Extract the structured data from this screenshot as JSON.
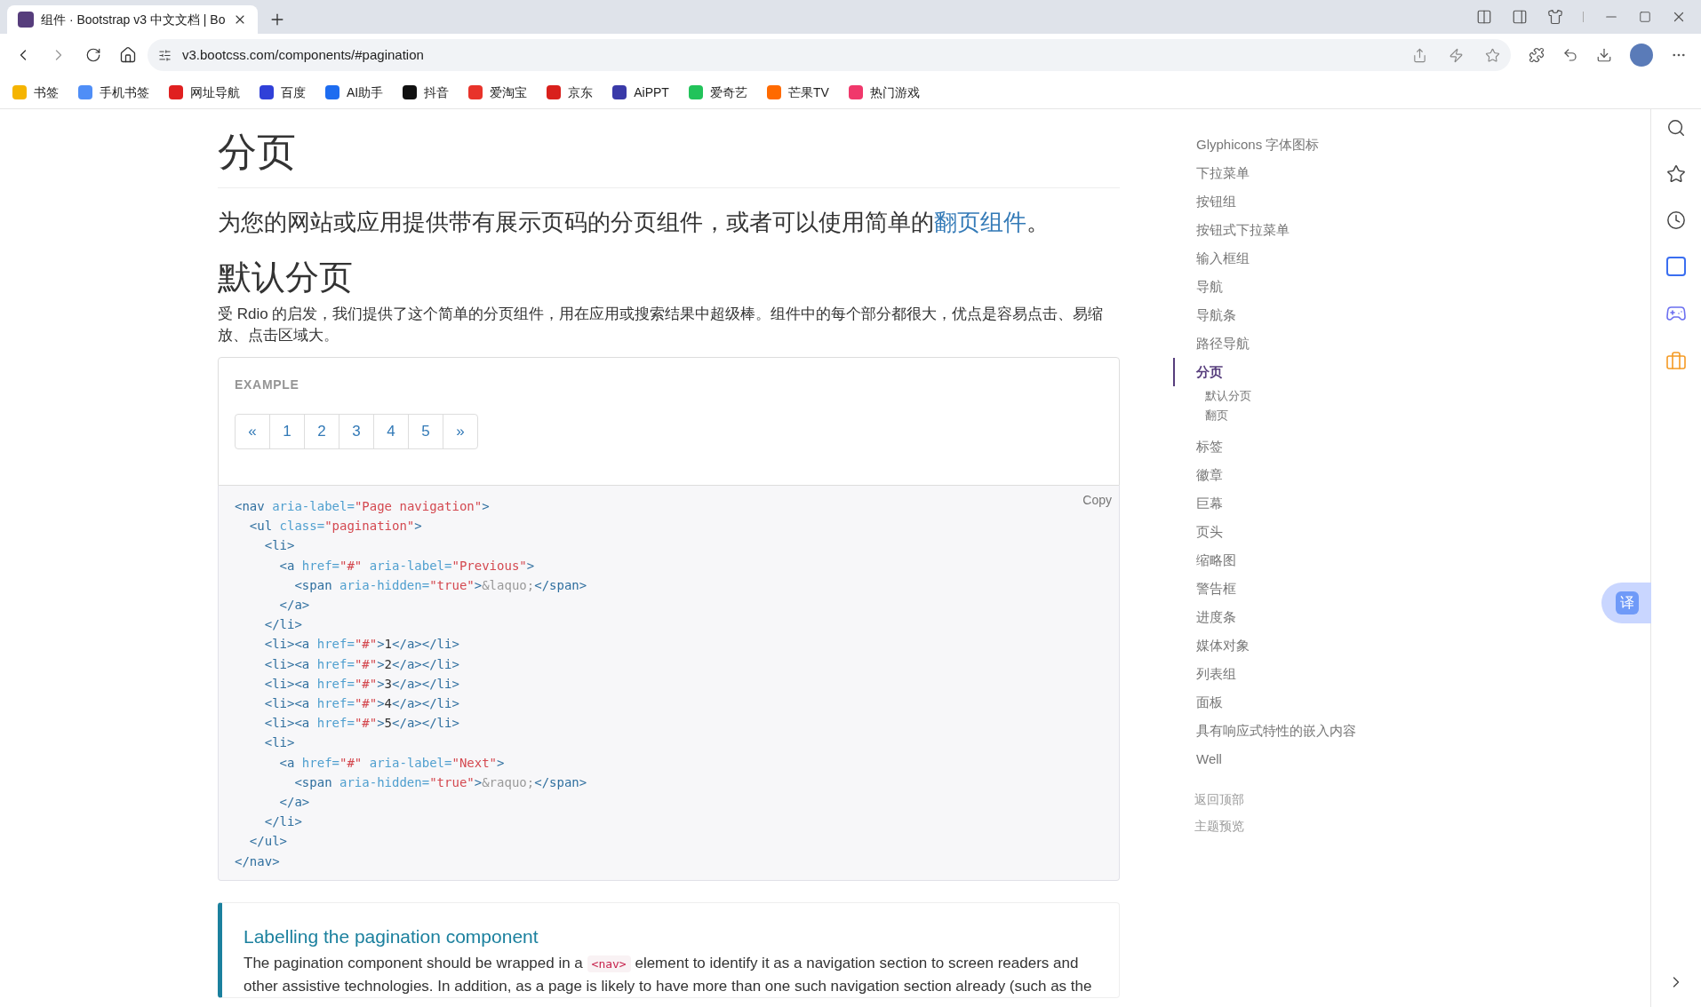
{
  "browser": {
    "tabs": [
      {
        "title": "组件 · Bootstrap v3 中文文档 | Bo",
        "selected": true
      }
    ],
    "url": "v3.bootcss.com/components/#pagination",
    "bookmarks": [
      {
        "label": "书签",
        "color": "#f5b400"
      },
      {
        "label": "手机书签",
        "color": "#4f8ef7"
      },
      {
        "label": "网址导航",
        "color": "#e02020"
      },
      {
        "label": "百度",
        "color": "#3040d8"
      },
      {
        "label": "AI助手",
        "color": "#1d6cf0"
      },
      {
        "label": "抖音",
        "color": "#111111"
      },
      {
        "label": "爱淘宝",
        "color": "#e8332a"
      },
      {
        "label": "京东",
        "color": "#d9201c"
      },
      {
        "label": "AiPPT",
        "color": "#3a3aa8"
      },
      {
        "label": "爱奇艺",
        "color": "#22c35a"
      },
      {
        "label": "芒果TV",
        "color": "#ff6a00"
      },
      {
        "label": "热门游戏",
        "color": "#f0386b"
      }
    ]
  },
  "page": {
    "title": "分页",
    "lead": "为您的网站或应用提供带有展示页码的分页组件，或者可以使用简单的",
    "lead_link": "翻页组件",
    "lead_end": "。",
    "section_title": "默认分页",
    "intro": "受 Rdio 的启发，我们提供了这个简单的分页组件，用在应用或搜索结果中超级棒。组件中的每个部分都很大，优点是容易点击、易缩放、点击区域大。",
    "example": {
      "label": "EXAMPLE",
      "pages": [
        "«",
        "1",
        "2",
        "3",
        "4",
        "5",
        "»"
      ]
    },
    "copy": "Copy",
    "code": [
      [
        {
          "kind": "tag",
          "text": "<nav "
        },
        {
          "kind": "attr",
          "text": "aria-label="
        },
        {
          "kind": "str",
          "text": "\"Page navigation\""
        },
        {
          "kind": "tag",
          "text": ">"
        }
      ],
      [
        {
          "kind": "tag",
          "text": "  <ul "
        },
        {
          "kind": "attr",
          "text": "class="
        },
        {
          "kind": "str",
          "text": "\"pagination\""
        },
        {
          "kind": "tag",
          "text": ">"
        }
      ],
      [
        {
          "kind": "tag",
          "text": "    <li>"
        }
      ],
      [
        {
          "kind": "tag",
          "text": "      <a "
        },
        {
          "kind": "attr",
          "text": "href="
        },
        {
          "kind": "str",
          "text": "\"#\""
        },
        {
          "kind": "attr",
          "text": " aria-label="
        },
        {
          "kind": "str",
          "text": "\"Previous\""
        },
        {
          "kind": "tag",
          "text": ">"
        }
      ],
      [
        {
          "kind": "tag",
          "text": "        <span "
        },
        {
          "kind": "attr",
          "text": "aria-hidden="
        },
        {
          "kind": "str",
          "text": "\"true\""
        },
        {
          "kind": "tag",
          "text": ">"
        },
        {
          "kind": "entity",
          "text": "&laquo;"
        },
        {
          "kind": "tag",
          "text": "</span>"
        }
      ],
      [
        {
          "kind": "tag",
          "text": "      </a>"
        }
      ],
      [
        {
          "kind": "tag",
          "text": "    </li>"
        }
      ],
      [
        {
          "kind": "tag",
          "text": "    <li><a "
        },
        {
          "kind": "attr",
          "text": "href="
        },
        {
          "kind": "str",
          "text": "\"#\""
        },
        {
          "kind": "tag",
          "text": ">"
        },
        {
          "kind": "text",
          "text": "1"
        },
        {
          "kind": "tag",
          "text": "</a></li>"
        }
      ],
      [
        {
          "kind": "tag",
          "text": "    <li><a "
        },
        {
          "kind": "attr",
          "text": "href="
        },
        {
          "kind": "str",
          "text": "\"#\""
        },
        {
          "kind": "tag",
          "text": ">"
        },
        {
          "kind": "text",
          "text": "2"
        },
        {
          "kind": "tag",
          "text": "</a></li>"
        }
      ],
      [
        {
          "kind": "tag",
          "text": "    <li><a "
        },
        {
          "kind": "attr",
          "text": "href="
        },
        {
          "kind": "str",
          "text": "\"#\""
        },
        {
          "kind": "tag",
          "text": ">"
        },
        {
          "kind": "text",
          "text": "3"
        },
        {
          "kind": "tag",
          "text": "</a></li>"
        }
      ],
      [
        {
          "kind": "tag",
          "text": "    <li><a "
        },
        {
          "kind": "attr",
          "text": "href="
        },
        {
          "kind": "str",
          "text": "\"#\""
        },
        {
          "kind": "tag",
          "text": ">"
        },
        {
          "kind": "text",
          "text": "4"
        },
        {
          "kind": "tag",
          "text": "</a></li>"
        }
      ],
      [
        {
          "kind": "tag",
          "text": "    <li><a "
        },
        {
          "kind": "attr",
          "text": "href="
        },
        {
          "kind": "str",
          "text": "\"#\""
        },
        {
          "kind": "tag",
          "text": ">"
        },
        {
          "kind": "text",
          "text": "5"
        },
        {
          "kind": "tag",
          "text": "</a></li>"
        }
      ],
      [
        {
          "kind": "tag",
          "text": "    <li>"
        }
      ],
      [
        {
          "kind": "tag",
          "text": "      <a "
        },
        {
          "kind": "attr",
          "text": "href="
        },
        {
          "kind": "str",
          "text": "\"#\""
        },
        {
          "kind": "attr",
          "text": " aria-label="
        },
        {
          "kind": "str",
          "text": "\"Next\""
        },
        {
          "kind": "tag",
          "text": ">"
        }
      ],
      [
        {
          "kind": "tag",
          "text": "        <span "
        },
        {
          "kind": "attr",
          "text": "aria-hidden="
        },
        {
          "kind": "str",
          "text": "\"true\""
        },
        {
          "kind": "tag",
          "text": ">"
        },
        {
          "kind": "entity",
          "text": "&raquo;"
        },
        {
          "kind": "tag",
          "text": "</span>"
        }
      ],
      [
        {
          "kind": "tag",
          "text": "      </a>"
        }
      ],
      [
        {
          "kind": "tag",
          "text": "    </li>"
        }
      ],
      [
        {
          "kind": "tag",
          "text": "  </ul>"
        }
      ],
      [
        {
          "kind": "tag",
          "text": "</nav>"
        }
      ]
    ],
    "callout": {
      "title": "Labelling the pagination component",
      "body": [
        {
          "kind": "text",
          "text": "The pagination component should be wrapped in a "
        },
        {
          "kind": "code",
          "text": "<nav>"
        },
        {
          "kind": "text",
          "text": " element to identify it as a navigation section to screen readers and other assistive technologies. In addition, as a page is likely to have more than one such navigation section already (such as the"
        }
      ]
    }
  },
  "sidenav": {
    "items": [
      {
        "label": "Glyphicons 字体图标",
        "selected": false
      },
      {
        "label": "下拉菜单",
        "selected": false
      },
      {
        "label": "按钮组",
        "selected": false
      },
      {
        "label": "按钮式下拉菜单",
        "selected": false
      },
      {
        "label": "输入框组",
        "selected": false
      },
      {
        "label": "导航",
        "selected": false
      },
      {
        "label": "导航条",
        "selected": false
      },
      {
        "label": "路径导航",
        "selected": false
      },
      {
        "label": "分页",
        "selected": true,
        "children": [
          {
            "label": "默认分页"
          },
          {
            "label": "翻页"
          }
        ]
      },
      {
        "label": "标签",
        "selected": false
      },
      {
        "label": "徽章",
        "selected": false
      },
      {
        "label": "巨幕",
        "selected": false
      },
      {
        "label": "页头",
        "selected": false
      },
      {
        "label": "缩略图",
        "selected": false
      },
      {
        "label": "警告框",
        "selected": false
      },
      {
        "label": "进度条",
        "selected": false
      },
      {
        "label": "媒体对象",
        "selected": false
      },
      {
        "label": "列表组",
        "selected": false
      },
      {
        "label": "面板",
        "selected": false
      },
      {
        "label": "具有响应式特性的嵌入内容",
        "selected": false
      },
      {
        "label": "Well",
        "selected": false
      }
    ],
    "footer_links": [
      "返回顶部",
      "主题预览"
    ]
  },
  "translate_button": "译"
}
